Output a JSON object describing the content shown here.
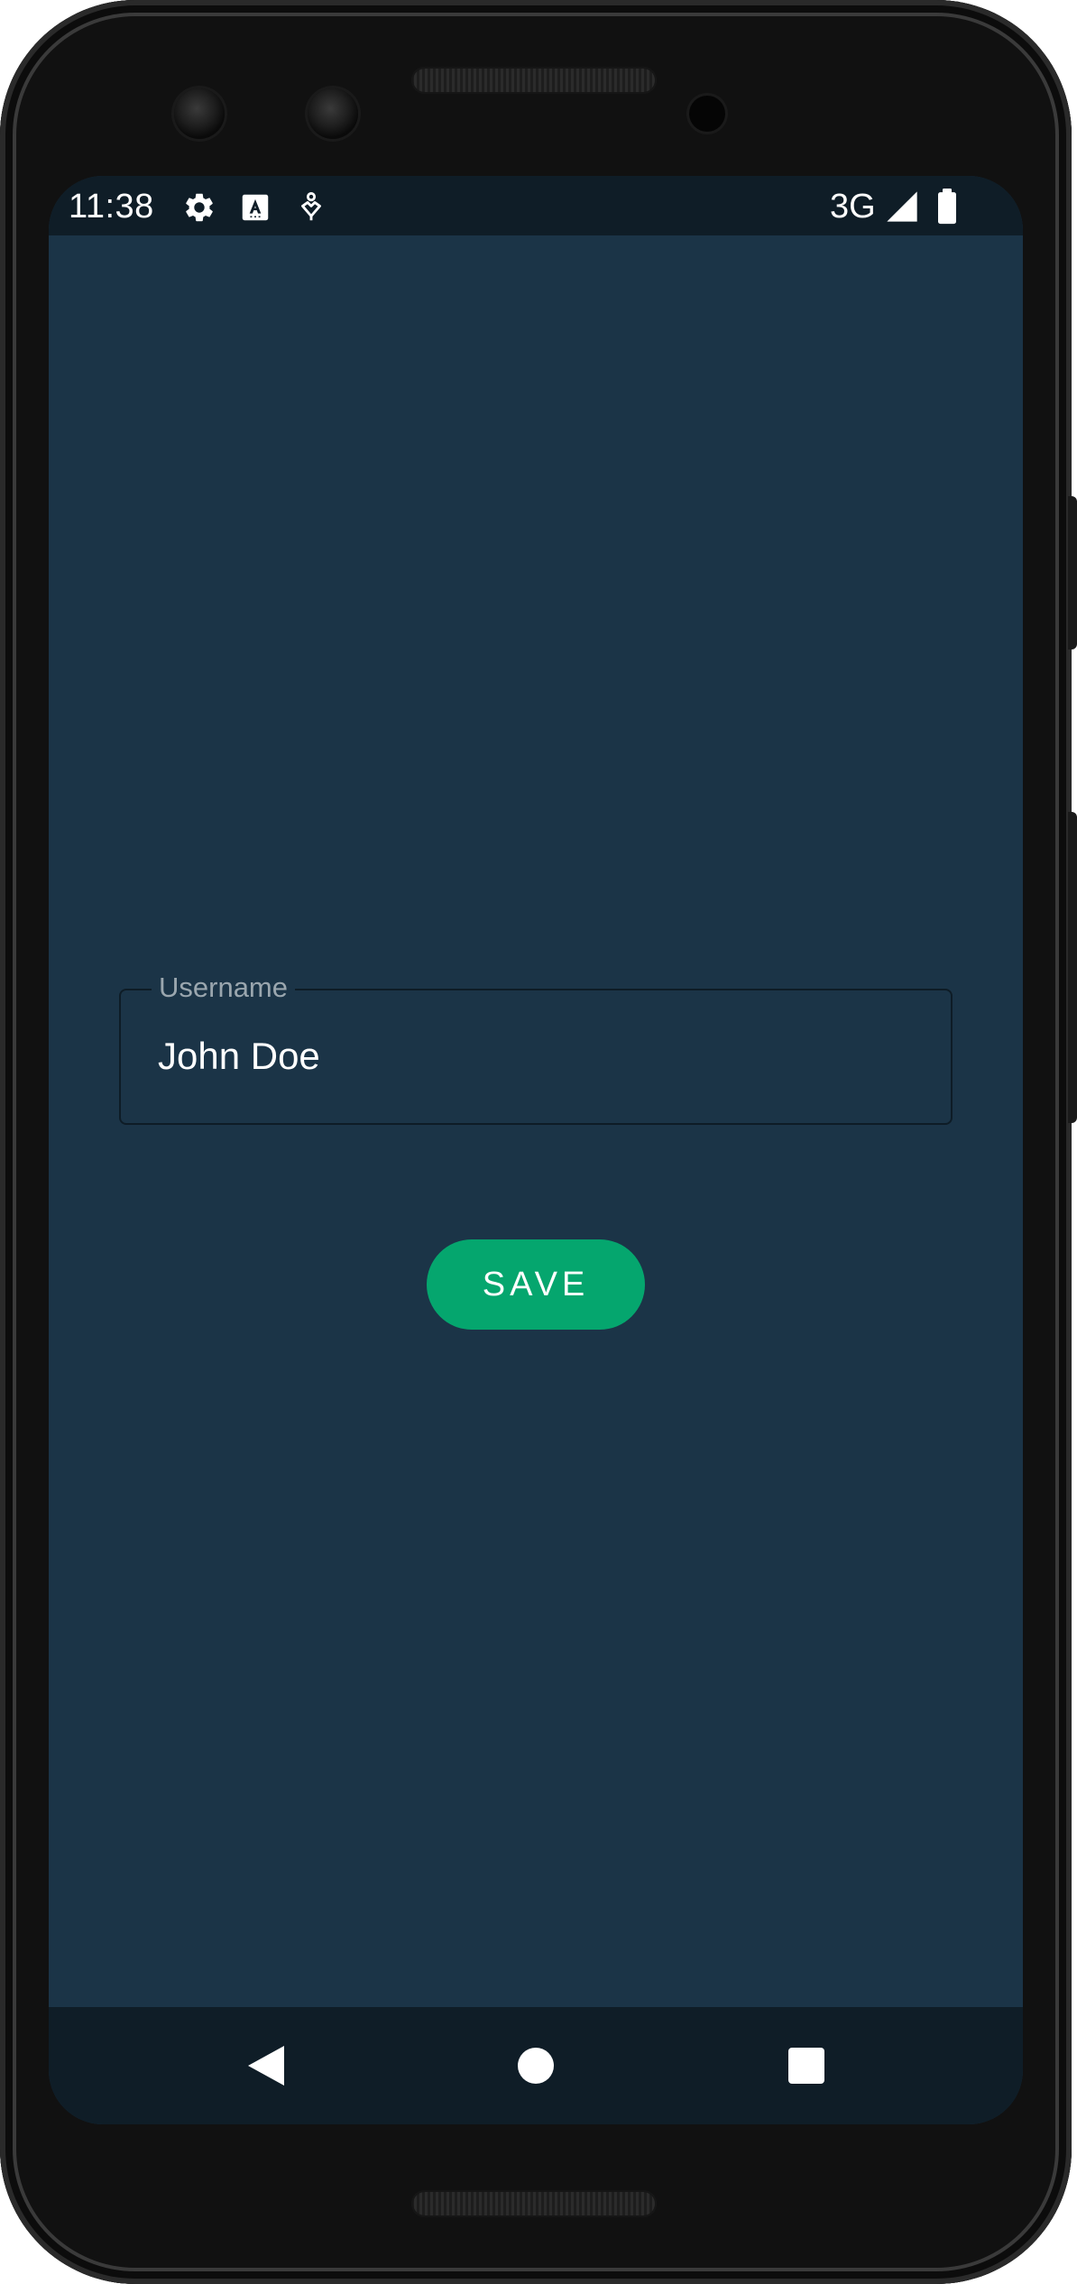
{
  "status_bar": {
    "time": "11:38",
    "icons": [
      "settings-gear-icon",
      "font-a-icon",
      "accessibility-person-icon"
    ],
    "network": "3G",
    "signal_icon": "cell-signal-icon",
    "battery_icon": "battery-icon"
  },
  "form": {
    "username_label": "Username",
    "username_value": "John Doe"
  },
  "actions": {
    "save_label": "SAVE"
  },
  "navigation": {
    "back_icon": "back-triangle-icon",
    "home_icon": "home-circle-icon",
    "recents_icon": "recents-square-icon"
  },
  "colors": {
    "background": "#1b3447",
    "system_bars": "#0f1d27",
    "accent": "#05a66e",
    "text_primary": "#ffffff",
    "label": "#9aa6ae"
  }
}
